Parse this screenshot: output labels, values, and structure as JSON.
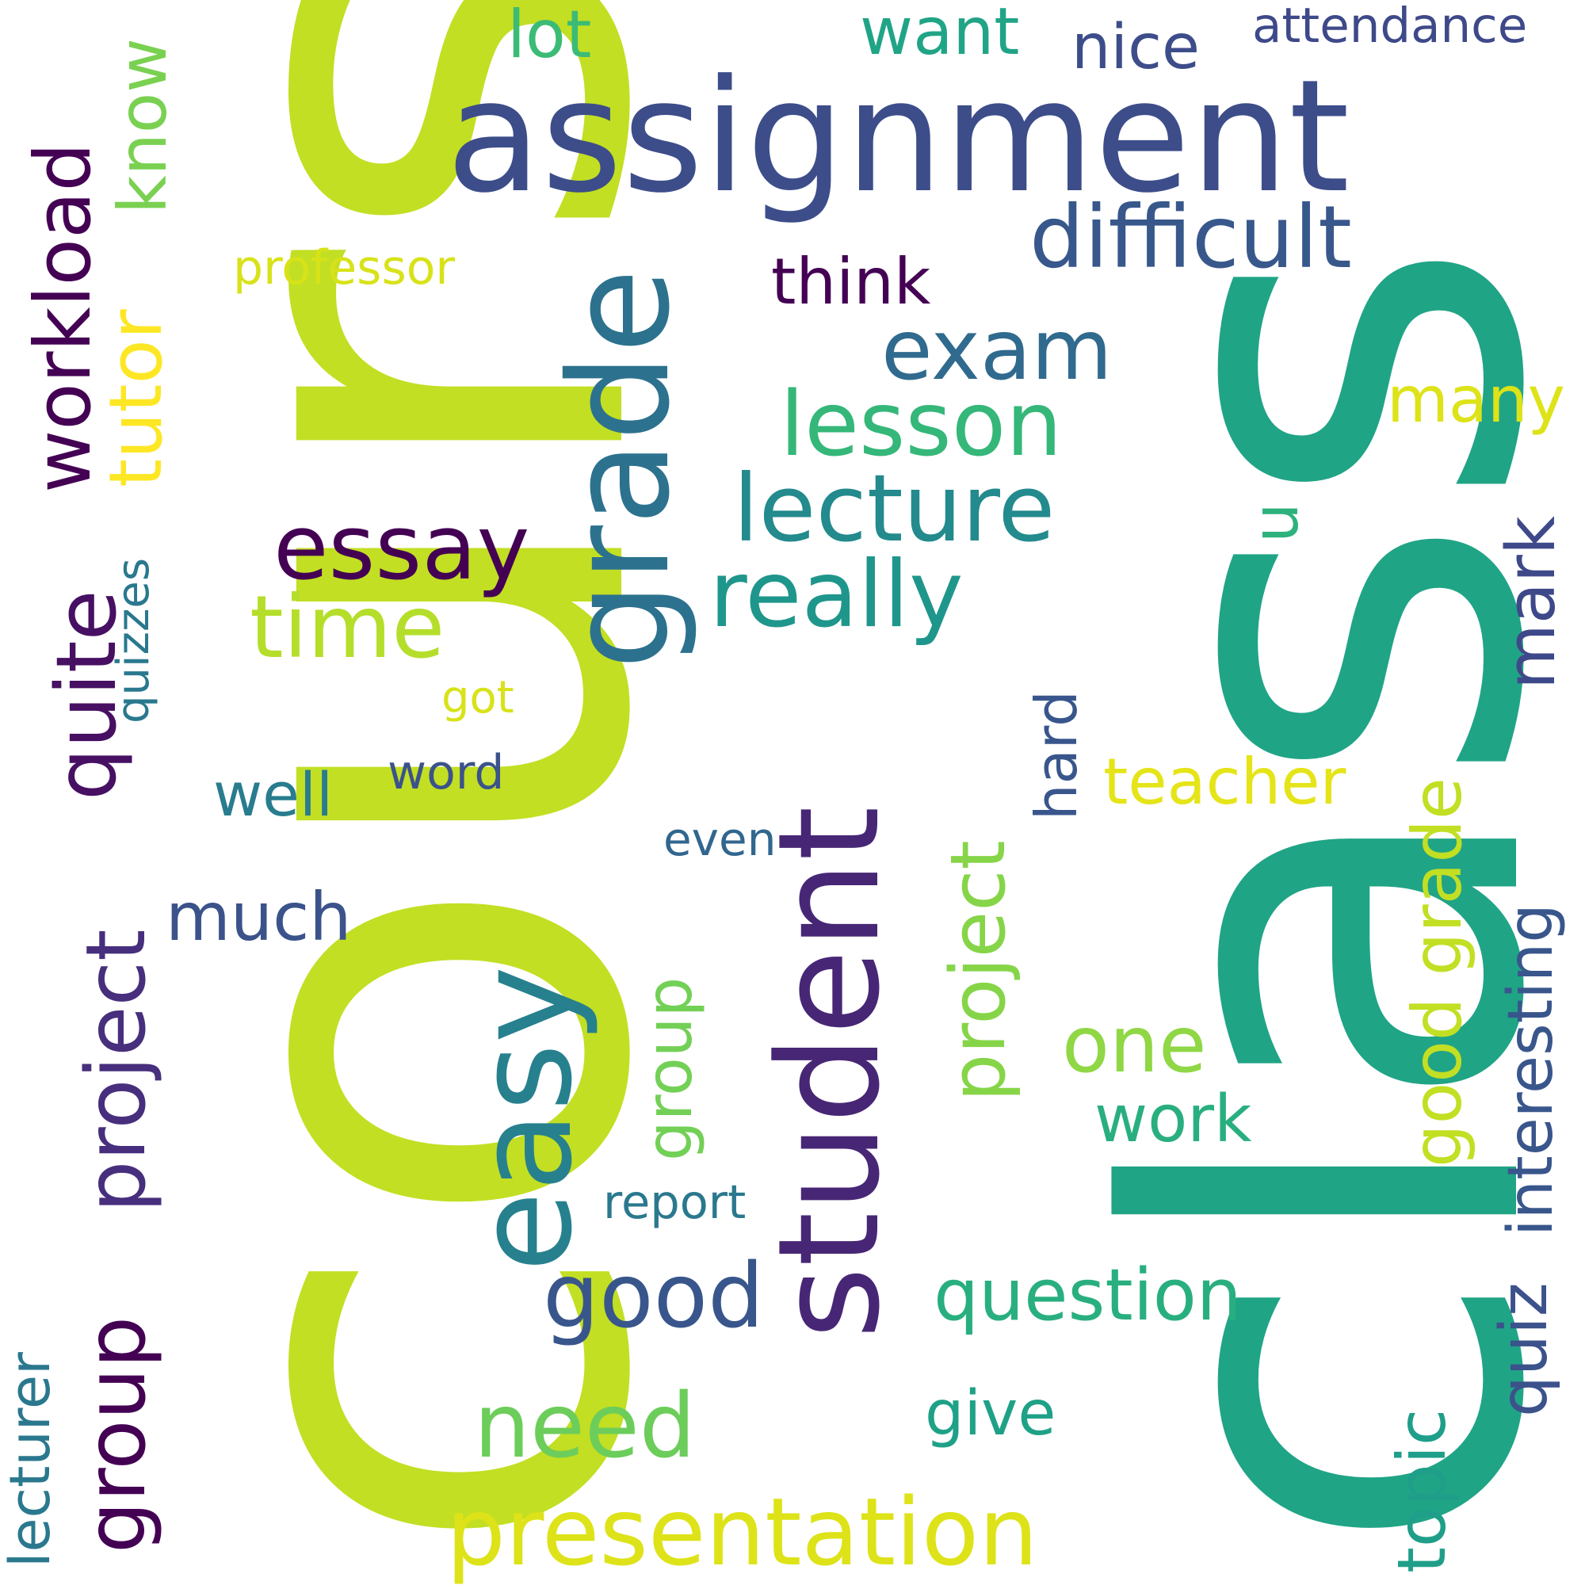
{
  "words": [
    {
      "text": "course",
      "color": "#c2df23",
      "orient": "vertical"
    },
    {
      "text": "class",
      "color": "#20a486",
      "orient": "vertical"
    },
    {
      "text": "assignment",
      "color": "#3d4d8a",
      "orient": "horizontal"
    },
    {
      "text": "student",
      "color": "#472775",
      "orient": "vertical"
    },
    {
      "text": "grade",
      "color": "#2c728e",
      "orient": "vertical"
    },
    {
      "text": "easy",
      "color": "#27808e",
      "orient": "vertical"
    },
    {
      "text": "workload",
      "color": "#440154",
      "orient": "vertical"
    },
    {
      "text": "difficult",
      "color": "#38588c",
      "orient": "horizontal"
    },
    {
      "text": "essay",
      "color": "#440154",
      "orient": "horizontal"
    },
    {
      "text": "lecture",
      "color": "#238a8d",
      "orient": "horizontal"
    },
    {
      "text": "really",
      "color": "#1f968b",
      "orient": "horizontal"
    },
    {
      "text": "lesson",
      "color": "#35b779",
      "orient": "horizontal"
    },
    {
      "text": "exam",
      "color": "#306a8e",
      "orient": "horizontal"
    },
    {
      "text": "quite",
      "color": "#471063",
      "orient": "vertical"
    },
    {
      "text": "project",
      "color": "#472f7d",
      "orient": "vertical"
    },
    {
      "text": "group",
      "color": "#440154",
      "orient": "vertical"
    },
    {
      "text": "tutor",
      "color": "#fde725",
      "orient": "vertical"
    },
    {
      "text": "know",
      "color": "#7ad151",
      "orient": "vertical"
    },
    {
      "text": "time",
      "color": "#b5de2b",
      "orient": "horizontal"
    },
    {
      "text": "good",
      "color": "#39568c",
      "orient": "horizontal"
    },
    {
      "text": "presentation",
      "color": "#dde318",
      "orient": "horizontal"
    },
    {
      "text": "need",
      "color": "#6ccd5a",
      "orient": "horizontal"
    },
    {
      "text": "question",
      "color": "#29af7f",
      "orient": "horizontal"
    },
    {
      "text": "project",
      "color": "#86d549",
      "orient": "vertical"
    },
    {
      "text": "group",
      "color": "#73d056",
      "orient": "vertical"
    },
    {
      "text": "one",
      "color": "#8fd744",
      "orient": "horizontal"
    },
    {
      "text": "work",
      "color": "#29af7f",
      "orient": "horizontal"
    },
    {
      "text": "hard",
      "color": "#39568c",
      "orient": "vertical"
    },
    {
      "text": "topic",
      "color": "#1f9e89",
      "orient": "vertical"
    },
    {
      "text": "quiz",
      "color": "#3b528b",
      "orient": "vertical"
    },
    {
      "text": "interesting",
      "color": "#39568c",
      "orient": "vertical"
    },
    {
      "text": "mark",
      "color": "#3e4989",
      "orient": "vertical"
    },
    {
      "text": "good grade",
      "color": "#c2df23",
      "orient": "vertical"
    },
    {
      "text": "many",
      "color": "#dde318",
      "orient": "horizontal"
    },
    {
      "text": "u",
      "color": "#2db27d",
      "orient": "vertical"
    },
    {
      "text": "teacher",
      "color": "#e5e419",
      "orient": "horizontal"
    },
    {
      "text": "think",
      "color": "#440154",
      "orient": "horizontal"
    },
    {
      "text": "much",
      "color": "#3b528b",
      "orient": "horizontal"
    },
    {
      "text": "well",
      "color": "#287c8e",
      "orient": "horizontal"
    },
    {
      "text": "word",
      "color": "#3b528b",
      "orient": "horizontal"
    },
    {
      "text": "even",
      "color": "#31668e",
      "orient": "horizontal"
    },
    {
      "text": "report",
      "color": "#2a788e",
      "orient": "horizontal"
    },
    {
      "text": "give",
      "color": "#1fa187",
      "orient": "horizontal"
    },
    {
      "text": "got",
      "color": "#d8e219",
      "orient": "horizontal"
    },
    {
      "text": "quizzes",
      "color": "#2a788e",
      "orient": "vertical"
    },
    {
      "text": "professor",
      "color": "#d8e219",
      "orient": "horizontal"
    },
    {
      "text": "lecturer",
      "color": "#2a788e",
      "orient": "vertical"
    },
    {
      "text": "lot",
      "color": "#3bbb75",
      "orient": "horizontal"
    },
    {
      "text": "want",
      "color": "#20a486",
      "orient": "horizontal"
    },
    {
      "text": "nice",
      "color": "#3d4d8a",
      "orient": "horizontal"
    },
    {
      "text": "attendance",
      "color": "#3e4989",
      "orient": "horizontal"
    }
  ]
}
